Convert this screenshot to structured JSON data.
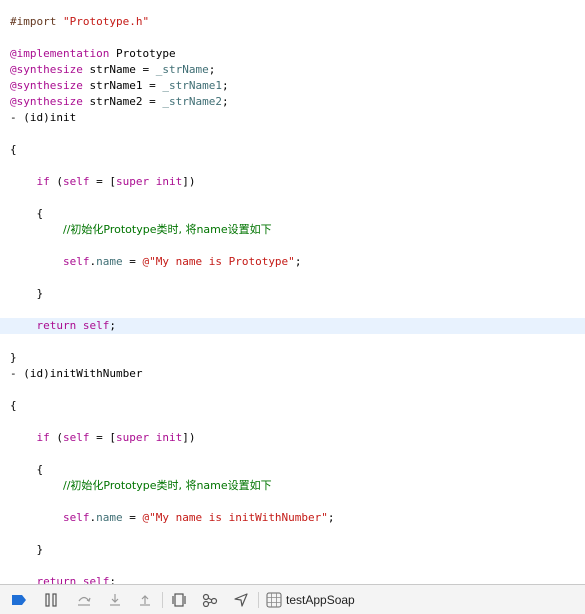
{
  "code": {
    "lines": [
      {
        "tokens": [
          {
            "t": "#import ",
            "c": "preproc"
          },
          {
            "t": "\"Prototype.h\"",
            "c": "str"
          }
        ]
      },
      {
        "tokens": []
      },
      {
        "tokens": [
          {
            "t": "@implementation",
            "c": "kw"
          },
          {
            "t": " Prototype",
            "c": ""
          }
        ]
      },
      {
        "tokens": [
          {
            "t": "@synthesize",
            "c": "kw"
          },
          {
            "t": " strName = ",
            "c": ""
          },
          {
            "t": "_strName",
            "c": "ivar"
          },
          {
            "t": ";",
            "c": ""
          }
        ]
      },
      {
        "tokens": [
          {
            "t": "@synthesize",
            "c": "kw"
          },
          {
            "t": " strName1 = ",
            "c": ""
          },
          {
            "t": "_strName1",
            "c": "ivar"
          },
          {
            "t": ";",
            "c": ""
          }
        ]
      },
      {
        "tokens": [
          {
            "t": "@synthesize",
            "c": "kw"
          },
          {
            "t": " strName2 = ",
            "c": ""
          },
          {
            "t": "_strName2",
            "c": "ivar"
          },
          {
            "t": ";",
            "c": ""
          }
        ]
      },
      {
        "tokens": [
          {
            "t": "- (id)init",
            "c": ""
          }
        ]
      },
      {
        "tokens": []
      },
      {
        "tokens": [
          {
            "t": "{",
            "c": ""
          }
        ]
      },
      {
        "tokens": []
      },
      {
        "tokens": [
          {
            "t": "    ",
            "c": ""
          },
          {
            "t": "if",
            "c": "kw"
          },
          {
            "t": " (",
            "c": ""
          },
          {
            "t": "self",
            "c": "kw"
          },
          {
            "t": " = [",
            "c": ""
          },
          {
            "t": "super",
            "c": "kw"
          },
          {
            "t": " ",
            "c": ""
          },
          {
            "t": "init",
            "c": "kw"
          },
          {
            "t": "])",
            "c": ""
          }
        ]
      },
      {
        "tokens": []
      },
      {
        "tokens": [
          {
            "t": "    {",
            "c": ""
          }
        ]
      },
      {
        "tokens": [
          {
            "t": "        ",
            "c": ""
          },
          {
            "t": "//初始化Prototype类时, 将name设置如下",
            "c": "comment"
          }
        ]
      },
      {
        "tokens": []
      },
      {
        "tokens": [
          {
            "t": "        ",
            "c": ""
          },
          {
            "t": "self",
            "c": "kw"
          },
          {
            "t": ".",
            "c": ""
          },
          {
            "t": "name",
            "c": "prop"
          },
          {
            "t": " = ",
            "c": ""
          },
          {
            "t": "@\"My name is Prototype\"",
            "c": "str"
          },
          {
            "t": ";",
            "c": ""
          }
        ]
      },
      {
        "tokens": []
      },
      {
        "tokens": [
          {
            "t": "    }",
            "c": ""
          }
        ]
      },
      {
        "tokens": []
      },
      {
        "tokens": [
          {
            "t": "    ",
            "c": ""
          },
          {
            "t": "return",
            "c": "kw"
          },
          {
            "t": " ",
            "c": ""
          },
          {
            "t": "self",
            "c": "kw"
          },
          {
            "t": ";",
            "c": ""
          }
        ],
        "highlight": true
      },
      {
        "tokens": []
      },
      {
        "tokens": [
          {
            "t": "}",
            "c": ""
          }
        ]
      },
      {
        "tokens": [
          {
            "t": "- (id)initWithNumber",
            "c": ""
          }
        ]
      },
      {
        "tokens": []
      },
      {
        "tokens": [
          {
            "t": "{",
            "c": ""
          }
        ]
      },
      {
        "tokens": []
      },
      {
        "tokens": [
          {
            "t": "    ",
            "c": ""
          },
          {
            "t": "if",
            "c": "kw"
          },
          {
            "t": " (",
            "c": ""
          },
          {
            "t": "self",
            "c": "kw"
          },
          {
            "t": " = [",
            "c": ""
          },
          {
            "t": "super",
            "c": "kw"
          },
          {
            "t": " ",
            "c": ""
          },
          {
            "t": "init",
            "c": "kw"
          },
          {
            "t": "])",
            "c": ""
          }
        ]
      },
      {
        "tokens": []
      },
      {
        "tokens": [
          {
            "t": "    {",
            "c": ""
          }
        ]
      },
      {
        "tokens": [
          {
            "t": "        ",
            "c": ""
          },
          {
            "t": "//初始化Prototype类时, 将name设置如下",
            "c": "comment"
          }
        ]
      },
      {
        "tokens": []
      },
      {
        "tokens": [
          {
            "t": "        ",
            "c": ""
          },
          {
            "t": "self",
            "c": "kw"
          },
          {
            "t": ".",
            "c": ""
          },
          {
            "t": "name",
            "c": "prop"
          },
          {
            "t": " = ",
            "c": ""
          },
          {
            "t": "@\"My name is initWithNumber\"",
            "c": "str"
          },
          {
            "t": ";",
            "c": ""
          }
        ]
      },
      {
        "tokens": []
      },
      {
        "tokens": [
          {
            "t": "    }",
            "c": ""
          }
        ]
      },
      {
        "tokens": []
      },
      {
        "tokens": [
          {
            "t": "    ",
            "c": ""
          },
          {
            "t": "return",
            "c": "kw"
          },
          {
            "t": " ",
            "c": ""
          },
          {
            "t": "self",
            "c": "kw"
          },
          {
            "t": ";",
            "c": ""
          }
        ]
      }
    ]
  },
  "debug_bar": {
    "buttons": [
      {
        "name": "breakpoints-toggle-icon",
        "active": true
      },
      {
        "name": "pause-icon"
      },
      {
        "name": "step-over-icon"
      },
      {
        "name": "step-into-icon"
      },
      {
        "name": "step-out-icon"
      },
      {
        "name": "view-debugger-icon"
      },
      {
        "name": "memory-graph-icon"
      },
      {
        "name": "simulate-location-icon"
      }
    ],
    "target": "testAppSoap",
    "accent_color": "#1f6fd6"
  }
}
